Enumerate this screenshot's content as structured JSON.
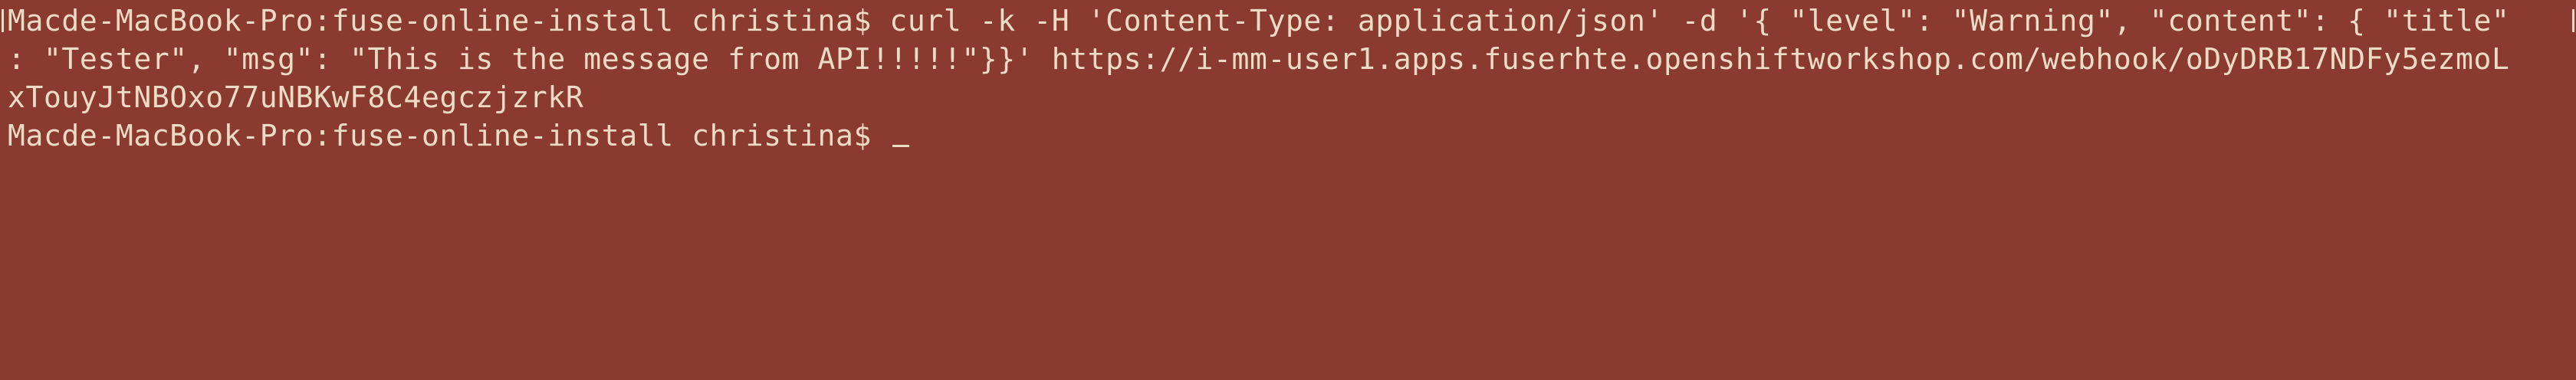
{
  "terminal": {
    "background": "#8a3a2f",
    "foreground": "#ecdcc4",
    "lines": [
      "Macde-MacBook-Pro:fuse-online-install christina$ curl -k -H 'Content-Type: application/json' -d '{ \"level\": \"Warning\", \"content\": { \"title\"",
      ": \"Tester\", \"msg\": \"This is the message from API!!!!!\"}}' https://i-mm-user1.apps.fuserhte.openshiftworkshop.com/webhook/oDyDRB17NDFy5ezmoL",
      "xTouyJtNBOxo77uNBKwF8C4egczjzrkR",
      "Macde-MacBook-Pro:fuse-online-install christina$ "
    ]
  }
}
